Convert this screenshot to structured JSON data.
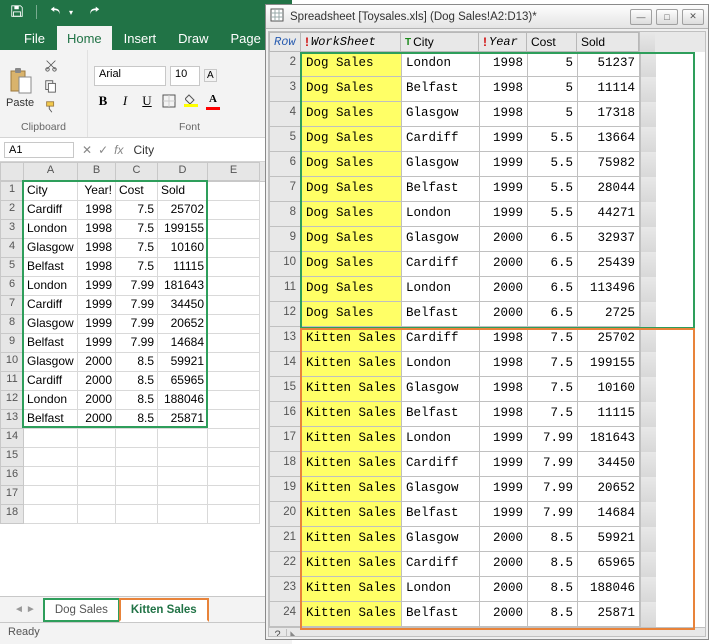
{
  "excel": {
    "tabs": {
      "file": "File",
      "home": "Home",
      "insert": "Insert",
      "draw": "Draw",
      "page": "Page L"
    },
    "clipboard": {
      "paste": "Paste",
      "group": "Clipboard"
    },
    "font": {
      "name": "Arial",
      "size": "10",
      "group": "Font"
    },
    "namebox": "A1",
    "formula": "City",
    "cols": [
      "A",
      "B",
      "C",
      "D",
      "E"
    ],
    "headers": {
      "city": "City",
      "year": "Year!",
      "cost": "Cost",
      "sold": "Sold"
    },
    "rows": [
      {
        "city": "Cardiff",
        "year": 1998,
        "cost": 7.5,
        "sold": 25702
      },
      {
        "city": "London",
        "year": 1998,
        "cost": 7.5,
        "sold": 199155
      },
      {
        "city": "Glasgow",
        "year": 1998,
        "cost": 7.5,
        "sold": 10160
      },
      {
        "city": "Belfast",
        "year": 1998,
        "cost": 7.5,
        "sold": 11115
      },
      {
        "city": "London",
        "year": 1999,
        "cost": 7.99,
        "sold": 181643
      },
      {
        "city": "Cardiff",
        "year": 1999,
        "cost": 7.99,
        "sold": 34450
      },
      {
        "city": "Glasgow",
        "year": 1999,
        "cost": 7.99,
        "sold": 20652
      },
      {
        "city": "Belfast",
        "year": 1999,
        "cost": 7.99,
        "sold": 14684
      },
      {
        "city": "Glasgow",
        "year": 2000,
        "cost": 8.5,
        "sold": 59921
      },
      {
        "city": "Cardiff",
        "year": 2000,
        "cost": 8.5,
        "sold": 65965
      },
      {
        "city": "London",
        "year": 2000,
        "cost": 8.5,
        "sold": 188046
      },
      {
        "city": "Belfast",
        "year": 2000,
        "cost": 8.5,
        "sold": 25871
      }
    ],
    "extra_rows": [
      14,
      15,
      16,
      17,
      18
    ],
    "sheets": {
      "dog": "Dog Sales",
      "kitten": "Kitten Sales"
    },
    "status": "Ready"
  },
  "preview": {
    "title": "Spreadsheet [Toysales.xls] (Dog Sales!A2:D13)*",
    "hdr": {
      "row": "Row",
      "ws": "WorkSheet",
      "city": "City",
      "year": "Year",
      "cost": "Cost",
      "sold": "Sold"
    },
    "rows": [
      {
        "n": 2,
        "ws": "Dog Sales",
        "city": "London",
        "year": 1998,
        "cost": 5,
        "sold": 51237
      },
      {
        "n": 3,
        "ws": "Dog Sales",
        "city": "Belfast",
        "year": 1998,
        "cost": 5,
        "sold": 11114
      },
      {
        "n": 4,
        "ws": "Dog Sales",
        "city": "Glasgow",
        "year": 1998,
        "cost": 5,
        "sold": 17318
      },
      {
        "n": 5,
        "ws": "Dog Sales",
        "city": "Cardiff",
        "year": 1999,
        "cost": 5.5,
        "sold": 13664
      },
      {
        "n": 6,
        "ws": "Dog Sales",
        "city": "Glasgow",
        "year": 1999,
        "cost": 5.5,
        "sold": 75982
      },
      {
        "n": 7,
        "ws": "Dog Sales",
        "city": "Belfast",
        "year": 1999,
        "cost": 5.5,
        "sold": 28044
      },
      {
        "n": 8,
        "ws": "Dog Sales",
        "city": "London",
        "year": 1999,
        "cost": 5.5,
        "sold": 44271
      },
      {
        "n": 9,
        "ws": "Dog Sales",
        "city": "Glasgow",
        "year": 2000,
        "cost": 6.5,
        "sold": 32937
      },
      {
        "n": 10,
        "ws": "Dog Sales",
        "city": "Cardiff",
        "year": 2000,
        "cost": 6.5,
        "sold": 25439
      },
      {
        "n": 11,
        "ws": "Dog Sales",
        "city": "London",
        "year": 2000,
        "cost": 6.5,
        "sold": 113496
      },
      {
        "n": 12,
        "ws": "Dog Sales",
        "city": "Belfast",
        "year": 2000,
        "cost": 6.5,
        "sold": 2725
      },
      {
        "n": 13,
        "ws": "Kitten Sales",
        "city": "Cardiff",
        "year": 1998,
        "cost": 7.5,
        "sold": 25702
      },
      {
        "n": 14,
        "ws": "Kitten Sales",
        "city": "London",
        "year": 1998,
        "cost": 7.5,
        "sold": 199155
      },
      {
        "n": 15,
        "ws": "Kitten Sales",
        "city": "Glasgow",
        "year": 1998,
        "cost": 7.5,
        "sold": 10160
      },
      {
        "n": 16,
        "ws": "Kitten Sales",
        "city": "Belfast",
        "year": 1998,
        "cost": 7.5,
        "sold": 11115
      },
      {
        "n": 17,
        "ws": "Kitten Sales",
        "city": "London",
        "year": 1999,
        "cost": 7.99,
        "sold": 181643
      },
      {
        "n": 18,
        "ws": "Kitten Sales",
        "city": "Cardiff",
        "year": 1999,
        "cost": 7.99,
        "sold": 34450
      },
      {
        "n": 19,
        "ws": "Kitten Sales",
        "city": "Glasgow",
        "year": 1999,
        "cost": 7.99,
        "sold": 20652
      },
      {
        "n": 20,
        "ws": "Kitten Sales",
        "city": "Belfast",
        "year": 1999,
        "cost": 7.99,
        "sold": 14684
      },
      {
        "n": 21,
        "ws": "Kitten Sales",
        "city": "Glasgow",
        "year": 2000,
        "cost": 8.5,
        "sold": 59921
      },
      {
        "n": 22,
        "ws": "Kitten Sales",
        "city": "Cardiff",
        "year": 2000,
        "cost": 8.5,
        "sold": 65965
      },
      {
        "n": 23,
        "ws": "Kitten Sales",
        "city": "London",
        "year": 2000,
        "cost": 8.5,
        "sold": 188046
      },
      {
        "n": 24,
        "ws": "Kitten Sales",
        "city": "Belfast",
        "year": 2000,
        "cost": 8.5,
        "sold": 25871
      }
    ]
  }
}
